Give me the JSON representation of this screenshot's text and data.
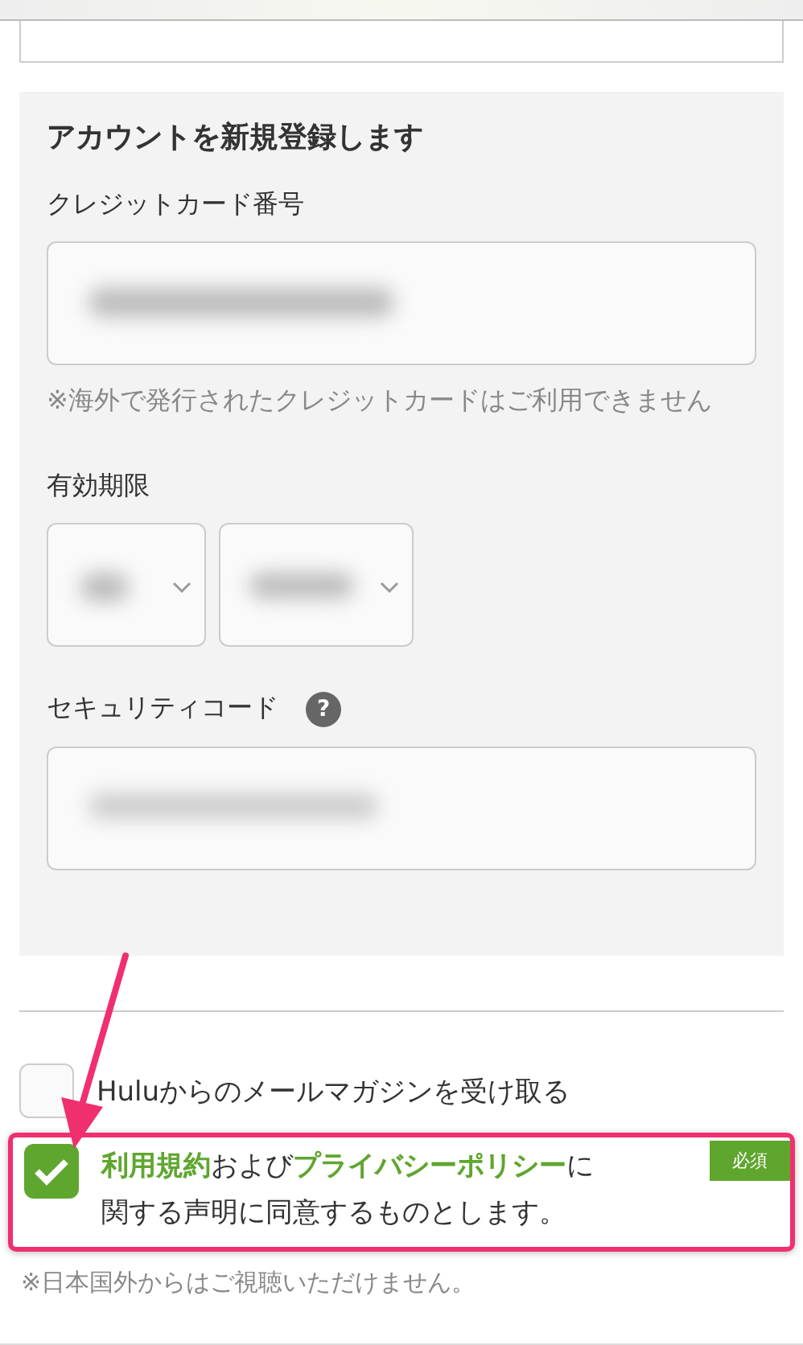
{
  "form": {
    "title": "アカウントを新規登録します",
    "card_number": {
      "label": "クレジットカード番号",
      "blurred": true
    },
    "card_note": "※海外で発行されたクレジットカードはご利用できません",
    "expiry": {
      "label": "有効期限",
      "selects": [
        {
          "blurred": true
        },
        {
          "blurred": true
        }
      ]
    },
    "security_code": {
      "label": "セキュリティコード",
      "help_icon": "?",
      "blurred": true
    }
  },
  "options": [
    {
      "kind": "newsletter",
      "checked": false,
      "segments": [
        {
          "text": "Huluからのメールマガジンを受け取る",
          "link": false
        }
      ]
    },
    {
      "kind": "agreement",
      "checked": true,
      "badge": "必須",
      "segments": [
        {
          "text": "利用規約",
          "link": true
        },
        {
          "text": "および",
          "link": false
        },
        {
          "text": "プライバシーポリシー",
          "link": true
        },
        {
          "text": "に関する声明に同意するものとします。",
          "link": false
        }
      ]
    }
  ],
  "footer_note": "※日本国外からはご視聴いただけません。"
}
